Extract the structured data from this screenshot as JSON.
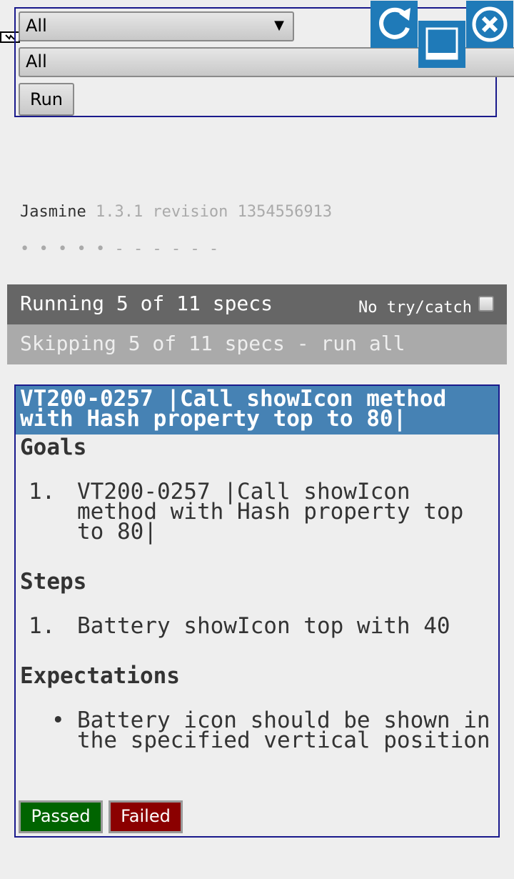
{
  "controls": {
    "suite_select_value": "All",
    "suite_select_arrow": "▼",
    "spec_select_value": "All",
    "run_label": "Run"
  },
  "window_buttons": {
    "reload_icon": "reload-icon",
    "minimize_icon": "minimize-icon",
    "close_icon": "close-icon",
    "color": "#1f7ab8"
  },
  "banner": {
    "name": "Jasmine",
    "version": "1.3.1 revision 1354556913"
  },
  "symbol_summary": "• • • • • - - - - - -",
  "status": {
    "running": "Running 5 of 11 specs",
    "no_try_catch": "No try/catch",
    "skipping": "Skipping 5 of 11 specs - run all"
  },
  "test_case": {
    "title": "VT200-0257 |Call showIcon method with Hash property top to 80|",
    "goals_title": "Goals",
    "goals": [
      {
        "marker": "1.",
        "text": "VT200-0257 |Call showIcon method with Hash property top to 80|"
      }
    ],
    "steps_title": "Steps",
    "steps": [
      {
        "marker": "1.",
        "text": "Battery showIcon top with 40"
      }
    ],
    "expectations_title": "Expectations",
    "expectations": [
      {
        "marker": "•",
        "text": "Battery icon should be shown in the specified vertical position"
      }
    ],
    "passed_label": "Passed",
    "failed_label": "Failed"
  },
  "colors": {
    "header_bg": "#4682b4",
    "running_bg": "#666666",
    "skipping_bg": "#aaaaaa",
    "passed_bg": "#006400",
    "failed_bg": "#8b0000",
    "panel_border": "#1a1a8c"
  }
}
